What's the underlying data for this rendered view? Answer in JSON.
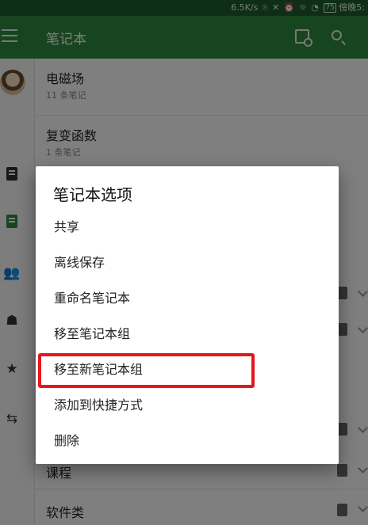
{
  "status_bar": {
    "network_speed": "6.5K/s",
    "icons": "⌾ ✕ ⏰ ☼ ◔",
    "battery": "75",
    "time": "傍晚5:"
  },
  "app_bar": {
    "title": "笔记本",
    "menu_icon": "menu-icon",
    "new_notebook_icon": "notebook-add-icon",
    "search_icon": "search-icon"
  },
  "nav_rail": {
    "items": [
      {
        "icon": "avatar"
      },
      {
        "icon": "note-icon"
      },
      {
        "icon": "notebook-icon"
      },
      {
        "icon": "people-icon"
      },
      {
        "icon": "work-chat-icon"
      },
      {
        "icon": "star-icon"
      },
      {
        "icon": "sync-icon"
      }
    ],
    "glyphs": {
      "people": "👥",
      "chat": "☗",
      "star": "★",
      "sync": "⇆"
    }
  },
  "notebooks": [
    {
      "title": "电磁场",
      "count": "11 条笔记"
    },
    {
      "title": "复变函数",
      "count": "1 条笔记"
    },
    {
      "title": "课程"
    },
    {
      "title": "软件类"
    }
  ],
  "dialog": {
    "title": "笔记本选项",
    "options": [
      "共享",
      "离线保存",
      "重命名笔记本",
      "移至笔记本组",
      "移至新笔记本组",
      "添加到快捷方式",
      "删除"
    ],
    "highlighted_option": "移至新笔记本组",
    "highlight_color": "#e5161d"
  },
  "colors": {
    "primary": "#2e8b3e",
    "status_bar": "#1d5f2a"
  }
}
